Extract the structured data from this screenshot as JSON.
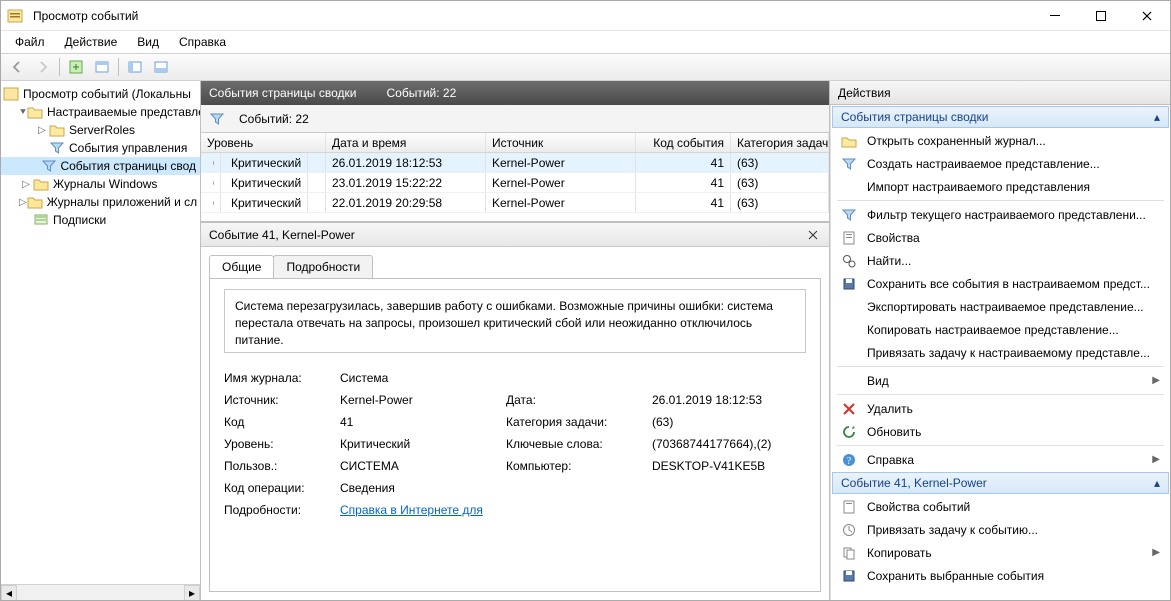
{
  "window": {
    "title": "Просмотр событий"
  },
  "menu": {
    "file": "Файл",
    "action": "Действие",
    "view": "Вид",
    "help": "Справка"
  },
  "tree": {
    "root": "Просмотр событий (Локальны",
    "custom": "Настраиваемые представле",
    "server_roles": "ServerRoles",
    "mgmt": "События управления",
    "summary": "События страницы свод",
    "winlogs": "Журналы Windows",
    "applogs": "Журналы приложений и сл",
    "subs": "Подписки"
  },
  "center": {
    "header_title": "События страницы сводки",
    "header_count": "Событий: 22",
    "filter_count": "Событий: 22",
    "cols": {
      "level": "Уровень",
      "date": "Дата и время",
      "src": "Источник",
      "code": "Код события",
      "cat": "Категория задачи"
    },
    "rows": [
      {
        "level": "Критический",
        "date": "26.01.2019 18:12:53",
        "src": "Kernel-Power",
        "code": "41",
        "cat": "(63)"
      },
      {
        "level": "Критический",
        "date": "23.01.2019 15:22:22",
        "src": "Kernel-Power",
        "code": "41",
        "cat": "(63)"
      },
      {
        "level": "Критический",
        "date": "22.01.2019 20:29:58",
        "src": "Kernel-Power",
        "code": "41",
        "cat": "(63)"
      }
    ]
  },
  "detail": {
    "title": "Событие 41, Kernel-Power",
    "tab_general": "Общие",
    "tab_details": "Подробности",
    "description": "Система перезагрузилась, завершив работу с ошибками. Возможные причины ошибки: система перестала отвечать на запросы, произошел критический сбой или неожиданно отключилось питание.",
    "labels": {
      "log": "Имя журнала:",
      "src": "Источник:",
      "code": "Код",
      "level": "Уровень:",
      "user": "Пользов.:",
      "opcode": "Код операции:",
      "more": "Подробности:",
      "date": "Дата:",
      "cat": "Категория задачи:",
      "keywords": "Ключевые слова:",
      "computer": "Компьютер:"
    },
    "values": {
      "log": "Система",
      "src": "Kernel-Power",
      "code": "41",
      "level": "Критический",
      "user": "СИСТЕМА",
      "opcode": "Сведения",
      "date": "26.01.2019 18:12:53",
      "cat": "(63)",
      "keywords": "(70368744177664),(2)",
      "computer": "DESKTOP-V41KE5B",
      "link": "Справка в Интернете для"
    }
  },
  "actions": {
    "header": "Действия",
    "section1": "События страницы сводки",
    "section2": "Событие 41, Kernel-Power",
    "items1": [
      "Открыть сохраненный журнал...",
      "Создать настраиваемое представление...",
      "Импорт настраиваемого представления"
    ],
    "items2": [
      "Фильтр текущего настраиваемого представлени...",
      "Свойства",
      "Найти...",
      "Сохранить все события в настраиваемом предст...",
      "Экспортировать настраиваемое представление...",
      "Копировать настраиваемое представление...",
      "Привязать задачу к настраиваемому представле..."
    ],
    "view": "Вид",
    "delete": "Удалить",
    "refresh": "Обновить",
    "help": "Справка",
    "items3": [
      "Свойства событий",
      "Привязать задачу к событию...",
      "Копировать",
      "Сохранить выбранные события"
    ]
  }
}
